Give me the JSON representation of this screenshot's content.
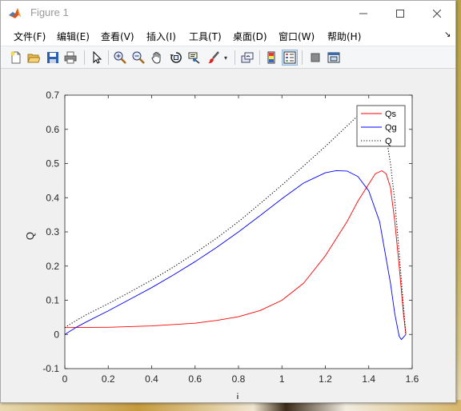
{
  "window": {
    "title": "Figure 1",
    "minimize_glyph": "—",
    "maximize_glyph": "☐",
    "close_glyph": "✕"
  },
  "menubar": {
    "items": [
      {
        "label": "文件(F)"
      },
      {
        "label": "编辑(E)"
      },
      {
        "label": "查看(V)"
      },
      {
        "label": "插入(I)"
      },
      {
        "label": "工具(T)"
      },
      {
        "label": "桌面(D)"
      },
      {
        "label": "窗口(W)"
      },
      {
        "label": "帮助(H)"
      }
    ],
    "dock_arrow": "↘"
  },
  "toolbar": {
    "buttons": [
      {
        "icon": "new-figure-icon"
      },
      {
        "icon": "open-file-icon"
      },
      {
        "icon": "save-icon"
      },
      {
        "icon": "print-icon"
      },
      {
        "icon": "edit-plot-arrow-icon"
      },
      {
        "icon": "zoom-in-icon"
      },
      {
        "icon": "zoom-out-icon"
      },
      {
        "icon": "pan-hand-icon"
      },
      {
        "icon": "rotate-3d-icon"
      },
      {
        "icon": "data-cursor-icon"
      },
      {
        "icon": "brush-icon"
      },
      {
        "icon": "link-plot-icon"
      },
      {
        "icon": "insert-colorbar-icon"
      },
      {
        "icon": "insert-legend-icon"
      },
      {
        "icon": "hide-plot-tools-icon"
      },
      {
        "icon": "show-plot-tools-icon"
      }
    ]
  },
  "chart_data": {
    "type": "line",
    "xlabel": "i",
    "ylabel": "Q",
    "xlim": [
      0,
      1.6
    ],
    "ylim": [
      -0.1,
      0.7
    ],
    "xticks": [
      "0",
      "0.2",
      "0.4",
      "0.6",
      "0.8",
      "1",
      "1.2",
      "1.4",
      "1.6"
    ],
    "yticks": [
      "-0.1",
      "0",
      "0.1",
      "0.2",
      "0.3",
      "0.4",
      "0.5",
      "0.6",
      "0.7"
    ],
    "xtick_values": [
      0,
      0.2,
      0.4,
      0.6,
      0.8,
      1.0,
      1.2,
      1.4,
      1.6
    ],
    "ytick_values": [
      -0.1,
      0,
      0.1,
      0.2,
      0.3,
      0.4,
      0.5,
      0.6,
      0.7
    ],
    "grid": false,
    "legend_position": "top-right",
    "series": [
      {
        "name": "Qs",
        "color": "#ff0000",
        "style": "solid",
        "x": [
          0,
          0.2,
          0.4,
          0.6,
          0.7,
          0.8,
          0.9,
          1.0,
          1.1,
          1.2,
          1.3,
          1.35,
          1.4,
          1.43,
          1.46,
          1.48,
          1.5,
          1.52,
          1.54,
          1.56,
          1.5708
        ],
        "y": [
          0.02,
          0.021,
          0.025,
          0.033,
          0.041,
          0.052,
          0.07,
          0.1,
          0.15,
          0.23,
          0.33,
          0.39,
          0.44,
          0.47,
          0.479,
          0.47,
          0.43,
          0.33,
          0.2,
          0.06,
          0
        ]
      },
      {
        "name": "Qg",
        "color": "#0000ff",
        "style": "solid",
        "x": [
          0,
          0.05,
          0.1,
          0.2,
          0.3,
          0.4,
          0.5,
          0.6,
          0.7,
          0.8,
          0.9,
          1.0,
          1.1,
          1.2,
          1.25,
          1.3,
          1.35,
          1.4,
          1.45,
          1.5,
          1.52,
          1.54,
          1.55,
          1.56,
          1.5708
        ],
        "y": [
          0,
          0.02,
          0.037,
          0.069,
          0.103,
          0.137,
          0.174,
          0.213,
          0.255,
          0.3,
          0.348,
          0.397,
          0.443,
          0.473,
          0.479,
          0.478,
          0.462,
          0.42,
          0.33,
          0.15,
          0.06,
          -0.005,
          -0.015,
          -0.008,
          0
        ]
      },
      {
        "name": "Q",
        "color": "#000000",
        "style": "dotted",
        "x": [
          0,
          0.05,
          0.1,
          0.2,
          0.3,
          0.4,
          0.5,
          0.6,
          0.7,
          0.8,
          0.9,
          1.0,
          1.1,
          1.2,
          1.3,
          1.35,
          1.4,
          1.45,
          1.48,
          1.5,
          1.52,
          1.54,
          1.56,
          1.5708
        ],
        "y": [
          0.02,
          0.04,
          0.058,
          0.09,
          0.124,
          0.159,
          0.197,
          0.238,
          0.282,
          0.33,
          0.383,
          0.437,
          0.493,
          0.55,
          0.61,
          0.64,
          0.66,
          0.63,
          0.58,
          0.5,
          0.39,
          0.24,
          0.08,
          0
        ]
      }
    ]
  }
}
